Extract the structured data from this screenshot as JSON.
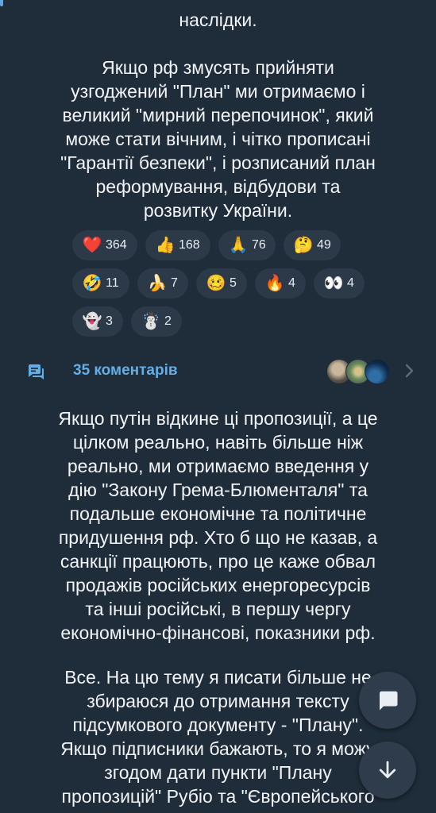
{
  "post": {
    "top_text": "наслідки.",
    "paragraph1": [
      " Якщо рф змусять прийняти",
      "узгоджений \"План\" ми отримаємо і",
      "великий \"мирний перепочинок\", який",
      "може стати вічним, і чітко прописані",
      "\"Гарантії безпеки\", і розписаний план",
      "реформування, відбудови  та",
      "розвитку України."
    ]
  },
  "reactions": [
    {
      "emoji": "❤️",
      "icon": "heart-icon",
      "count": "364"
    },
    {
      "emoji": "👍",
      "icon": "thumbs-up-icon",
      "count": "168"
    },
    {
      "emoji": "🙏",
      "icon": "praying-hands-icon",
      "count": "76"
    },
    {
      "emoji": "🤔",
      "icon": "thinking-face-icon",
      "count": "49"
    },
    {
      "emoji": "🤣",
      "icon": "rofl-icon",
      "count": "11"
    },
    {
      "emoji": "🍌",
      "icon": "banana-icon",
      "count": "7"
    },
    {
      "emoji": "🥴",
      "icon": "woozy-face-icon",
      "count": "5"
    },
    {
      "emoji": "🔥",
      "icon": "fire-icon",
      "count": "4"
    },
    {
      "emoji": "👀",
      "icon": "eyes-icon",
      "count": "4"
    },
    {
      "emoji": "👻",
      "icon": "ghost-icon",
      "count": "3"
    },
    {
      "emoji": "☃️",
      "icon": "snowman-icon",
      "count": "2"
    }
  ],
  "comments": {
    "label": "35 коментарів",
    "icon": "comments-icon"
  },
  "body": {
    "paragraph2": [
      "Якщо путін відкине ці пропозиції, а це",
      "цілком реально, навіть більше ніж",
      "реально, ми отримаємо введення у",
      "дію \"Закону Грема-Блюменталя\" та",
      "подальше економічне та політичне",
      "придушення рф. Хто б що не казав, а",
      "санкції працюють, про це каже обвал",
      "продажів російських енергоресурсів",
      "та інші російські, в першу чергу",
      "економічно-фінансові, показники рф."
    ],
    "paragraph3": [
      " Все. На цю тему я писати більше не",
      "збираюся до отримання тексту",
      "підсумкового документу - \"Плану\".",
      "Якщо підписники бажають, то я можу",
      "згодом дати пункти \"Плану",
      "пропозицій\" Рубіо та \"Європейського"
    ]
  },
  "colors": {
    "background": "#1f2c3a",
    "accent": "#64aee6",
    "reaction_bg": "#2b3948",
    "fab_bg": "#2e3c4b"
  }
}
